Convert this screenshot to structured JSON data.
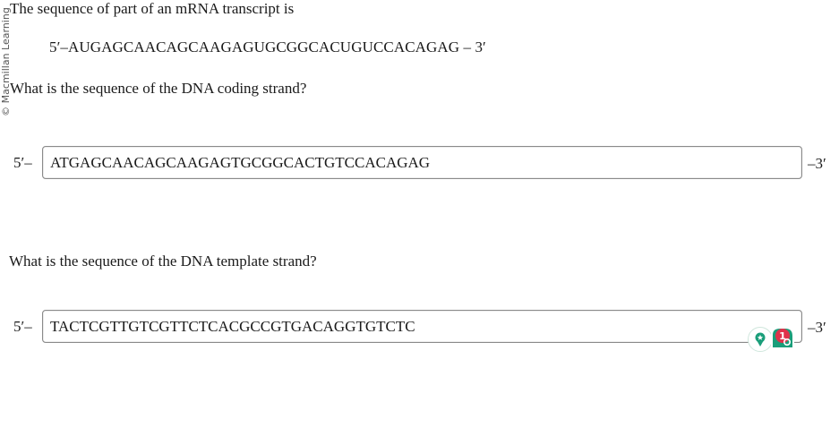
{
  "watermark": "© Macmillan Learning",
  "question_intro": "The sequence of part of an mRNA transcript is",
  "mrna_sequence": "5′–AUGAGCAACAGCAAGAGUGCGGCACUGUCCACAGAG – 3′",
  "coding_strand": {
    "question": "What is the sequence of the DNA coding strand?",
    "prefix": "5′–",
    "value": "ATGAGCAACAGCAAGAGTGCGGCACTGTCCACAGAG",
    "suffix": "–3′"
  },
  "template_strand": {
    "question": "What is the sequence of the DNA template strand?",
    "prefix": "5′–",
    "value": "TACTCGTTGTCGTTCTCACGCCGTGACAGGTGTCTC",
    "suffix": "–3′"
  },
  "extension_badge": {
    "count": "1",
    "icons": [
      "pin-icon",
      "grammar-extension-icon"
    ],
    "colors": {
      "teal": "#1a9e7a",
      "red": "#e0324b"
    }
  }
}
